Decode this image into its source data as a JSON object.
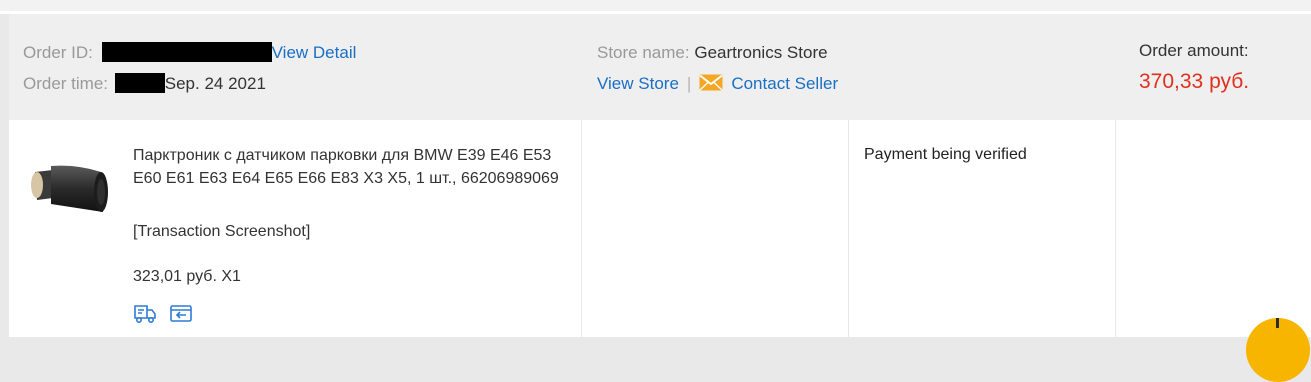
{
  "order": {
    "id_label": "Order ID:",
    "view_detail": "View Detail",
    "time_label": "Order time:",
    "time_value": "Sep. 24 2021",
    "store_label": "Store name:",
    "store_name": "Geartronics Store",
    "view_store": "View Store",
    "separator": "|",
    "contact_seller": "Contact Seller",
    "amount_label": "Order amount:",
    "amount_value": "370,33 руб."
  },
  "product": {
    "title": "Парктроник с датчиком парковки для BMW E39 E46 E53 E60 E61 E63 E64 E65 E66 E83 X3 X5, 1 шт., 66206989069",
    "note": "[Transaction Screenshot]",
    "price": "323,01 руб. X1"
  },
  "status": {
    "text": "Payment being verified"
  },
  "icons": {
    "contact": "envelope-icon",
    "tracking": "delivery-truck-icon",
    "return": "return-box-icon",
    "chat": "chat-bubble-icon"
  },
  "colors": {
    "link": "#1a6fc4",
    "amount": "#e0301e",
    "mail": "#f5a623",
    "chat": "#f7b500"
  }
}
